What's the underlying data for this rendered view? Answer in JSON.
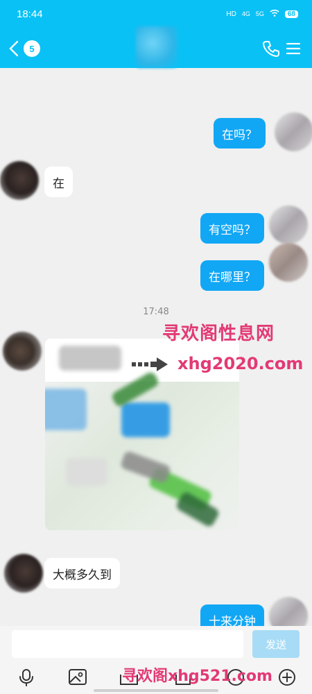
{
  "status_bar": {
    "time": "18:44",
    "network_hd": "HD",
    "net_4g": "4G",
    "net_5g": "5G",
    "battery": "68"
  },
  "header": {
    "unread_count": "5"
  },
  "messages": [
    {
      "from": "me",
      "text": "在吗？"
    },
    {
      "from": "them",
      "text": "在"
    },
    {
      "from": "me",
      "text": "有空吗？"
    },
    {
      "from": "me",
      "text": "在哪里？"
    },
    {
      "from": "them",
      "text": "大概多久到"
    },
    {
      "from": "me",
      "text": "十来分钟"
    }
  ],
  "timestamp": "17:48",
  "watermark": {
    "title": "寻欢阁性息网",
    "url": "xhg2020.com",
    "bottom": "寻欢阁xhg521.com"
  },
  "input": {
    "value": "",
    "send_label": "发送"
  },
  "colors": {
    "brand": "#0ac1f5",
    "my_bubble": "#12a7f5",
    "watermark": "#e23a74"
  }
}
